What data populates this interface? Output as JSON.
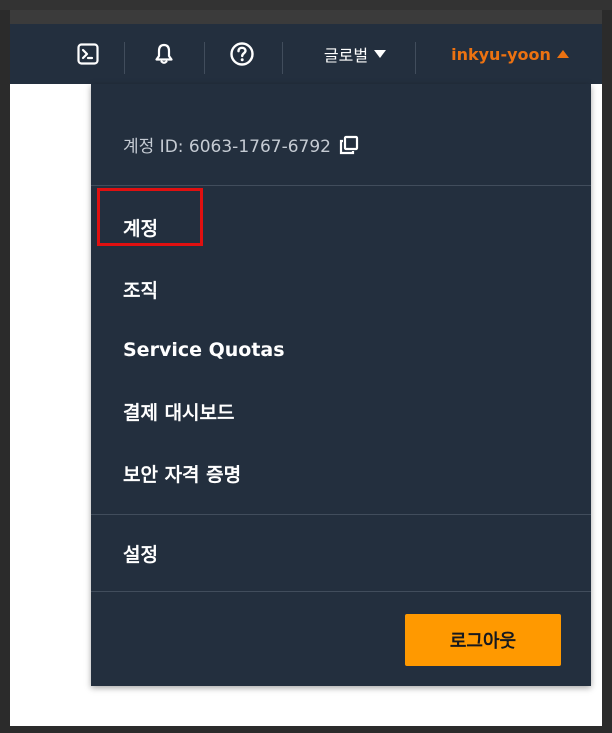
{
  "navbar": {
    "cloudshell_icon": "cloudshell-icon",
    "notifications_icon": "bell-icon",
    "help_icon": "help-icon",
    "region_label": "글로벌",
    "user_label": "inkyu-yoon",
    "user_color": "#ec7211"
  },
  "dropdown": {
    "account_id_label": "계정 ID: 6063-1767-6792",
    "copy_icon": "copy-icon",
    "items": [
      {
        "label": "계정"
      },
      {
        "label": "조직"
      },
      {
        "label": "Service Quotas"
      },
      {
        "label": "결제 대시보드"
      },
      {
        "label": "보안 자격 증명"
      }
    ],
    "settings_label": "설정",
    "logout_label": "로그아웃",
    "logout_color": "#ff9900",
    "highlight_color": "#e01010"
  }
}
